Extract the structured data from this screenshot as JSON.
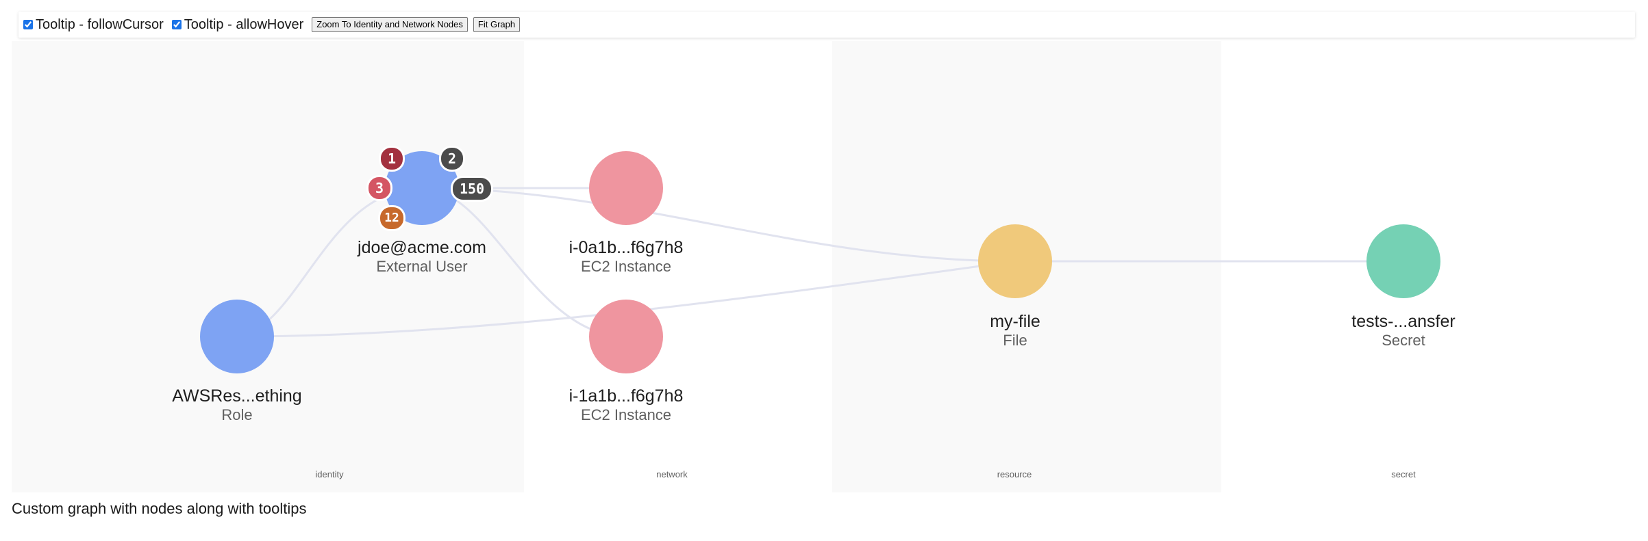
{
  "toolbar": {
    "follow_cursor_label": "Tooltip - followCursor",
    "follow_cursor_checked": true,
    "allow_hover_label": "Tooltip - allowHover",
    "allow_hover_checked": true,
    "zoom_button_label": "Zoom To Identity and Network Nodes",
    "fit_button_label": "Fit Graph"
  },
  "bands": [
    {
      "label": "identity"
    },
    {
      "label": "network"
    },
    {
      "label": "resource"
    },
    {
      "label": "secret"
    }
  ],
  "nodes": {
    "awsres": {
      "name": "AWSRes...ething",
      "type": "Role",
      "color": "#7ea3f3"
    },
    "jdoe": {
      "name": "jdoe@acme.com",
      "type": "External User",
      "color": "#7ea3f3"
    },
    "i0a1b": {
      "name": "i-0a1b...f6g7h8",
      "type": "EC2 Instance",
      "color": "#ef959f"
    },
    "i1a1b": {
      "name": "i-1a1b...f6g7h8",
      "type": "EC2 Instance",
      "color": "#ef959f"
    },
    "myfile": {
      "name": "my-file",
      "type": "File",
      "color": "#f0c97b"
    },
    "tests": {
      "name": "tests-...ansfer",
      "type": "Secret",
      "color": "#75d1b4"
    }
  },
  "badges": [
    {
      "text": "1",
      "color": "#a3313f"
    },
    {
      "text": "2",
      "color": "#4b4b4b"
    },
    {
      "text": "3",
      "color": "#d45563"
    },
    {
      "text": "150",
      "color": "#4b4b4b"
    },
    {
      "text": "12",
      "color": "#c7692b"
    }
  ],
  "caption": "Custom graph with nodes along with tooltips"
}
